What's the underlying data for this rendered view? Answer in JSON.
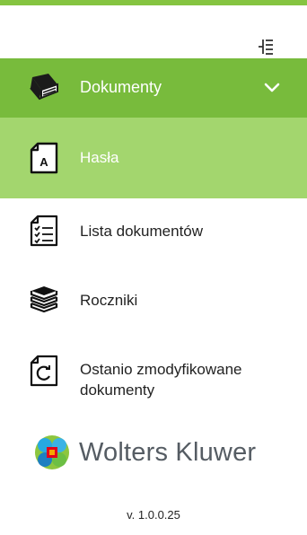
{
  "sidebar": {
    "collapse_icon": "collapse-tree-icon",
    "section": {
      "label": "Dokumenty",
      "icon": "book-icon",
      "chevron": "chevron-down-icon",
      "background": "#78bb3c"
    },
    "items": [
      {
        "label": "Hasła",
        "icon": "document-a-icon",
        "active": true,
        "background": "#a3d66e"
      },
      {
        "label": "Lista dokumentów",
        "icon": "checklist-document-icon",
        "active": false
      },
      {
        "label": "Roczniki",
        "icon": "books-stack-icon",
        "active": false
      },
      {
        "label": "Ostanio zmodyfikowane dokumenty",
        "icon": "refresh-document-icon",
        "active": false
      }
    ]
  },
  "brand": {
    "name": "Wolters Kluwer",
    "logo_icon": "wolters-kluwer-logo-icon"
  },
  "footer": {
    "version": "v. 1.0.0.25"
  },
  "colors": {
    "accent_top": "#85c441",
    "header_green": "#78bb3c",
    "active_green": "#a3d66e"
  }
}
